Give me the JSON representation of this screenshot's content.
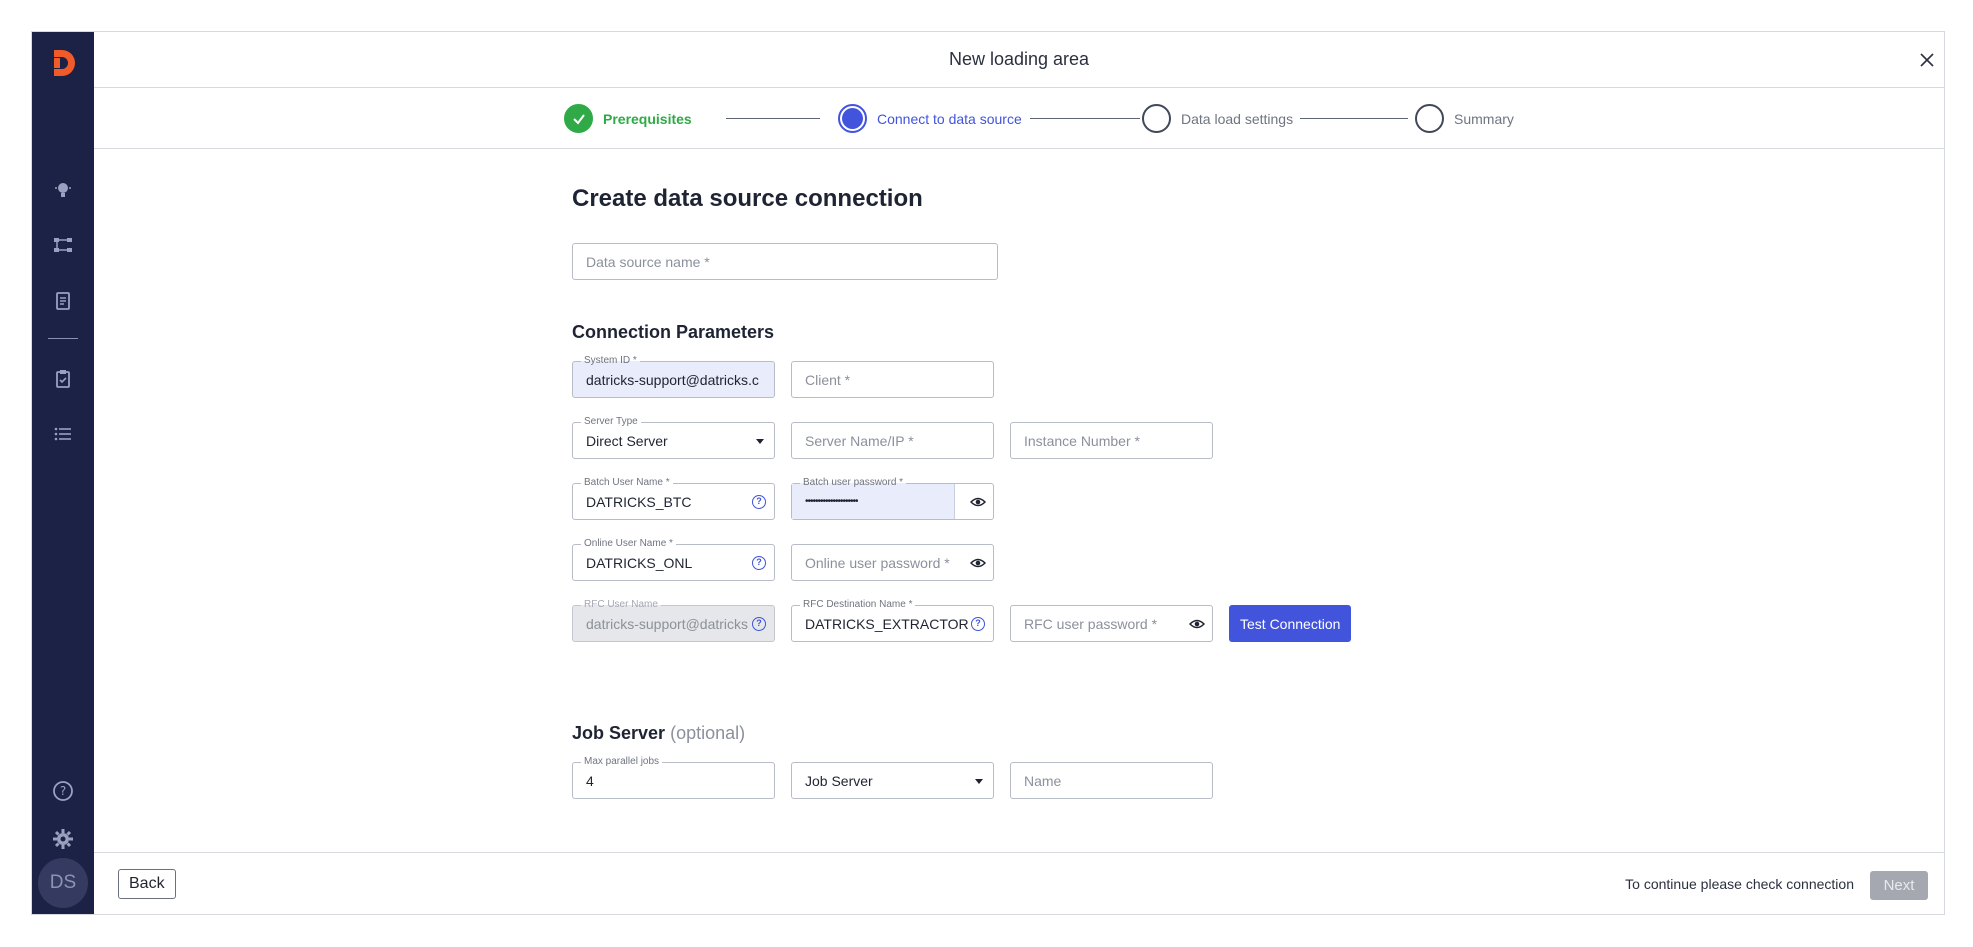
{
  "app": {
    "title": "New loading area",
    "user_initials": "DS"
  },
  "sidebar": {
    "items": [
      {
        "icon": "lightbulb-icon"
      },
      {
        "icon": "flow-icon"
      },
      {
        "icon": "document-icon"
      },
      {
        "icon": "clipboard-check-icon"
      },
      {
        "icon": "list-icon"
      },
      {
        "icon": "help-icon"
      },
      {
        "icon": "gear-icon"
      }
    ]
  },
  "stepper": {
    "steps": [
      {
        "label": "Prerequisites",
        "state": "done"
      },
      {
        "label": "Connect to data source",
        "state": "active"
      },
      {
        "label": "Data load settings",
        "state": "pending"
      },
      {
        "label": "Summary",
        "state": "pending"
      }
    ]
  },
  "form": {
    "heading": "Create data source connection",
    "data_source_name_placeholder": "Data source name *",
    "connection_heading": "Connection Parameters",
    "system_id": {
      "label": "System ID *",
      "value": "datricks-support@datricks.c"
    },
    "client_placeholder": "Client *",
    "server_type": {
      "label": "Server Type",
      "value": "Direct Server"
    },
    "server_name_placeholder": "Server Name/IP *",
    "instance_number_placeholder": "Instance Number *",
    "batch_user_name": {
      "label": "Batch User Name *",
      "value": "DATRICKS_BTC"
    },
    "batch_user_password": {
      "label": "Batch user password *",
      "value": "•••••••••••••••••••••"
    },
    "online_user_name": {
      "label": "Online User Name *",
      "value": "DATRICKS_ONL"
    },
    "online_user_password_placeholder": "Online user password *",
    "rfc_user_name": {
      "label": "RFC User Name",
      "value": "datricks-support@datricks"
    },
    "rfc_destination_name": {
      "label": "RFC Destination Name *",
      "value": "DATRICKS_EXTRACTOR"
    },
    "rfc_user_password_placeholder": "RFC user password *",
    "test_connection_label": "Test Connection",
    "job_server_heading": "Job Server",
    "job_server_optional": "(optional)",
    "max_parallel_jobs": {
      "label": "Max parallel jobs",
      "value": "4"
    },
    "job_server_select": "Job Server",
    "name_placeholder": "Name"
  },
  "footer": {
    "back_label": "Back",
    "hint": "To continue please check connection",
    "next_label": "Next"
  },
  "colors": {
    "sidebar_bg": "#1c2245",
    "accent": "#4254dc",
    "success": "#2faa47"
  }
}
